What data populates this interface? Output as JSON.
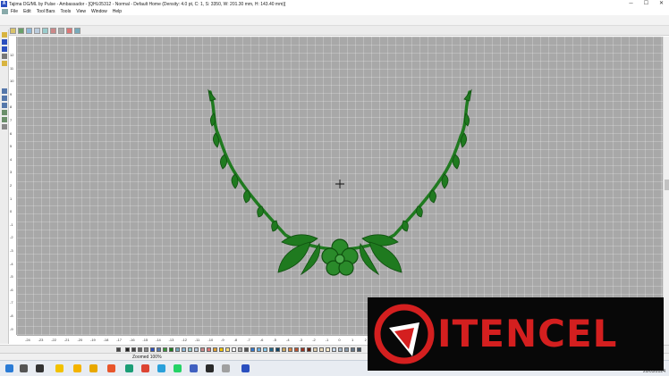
{
  "window": {
    "title": "Tajima DG/ML by Pulse - Ambassador - [QHL05312 - Normal - Default Home (Density: 4.0 pt, C: 1, S: 3350, W: 201.30 mm, H: 143.40 mm)]",
    "minimize": "─",
    "maximize": "☐",
    "close": "✕"
  },
  "menu": {
    "items": [
      "File",
      "Edit",
      "Tool Bars",
      "Tools",
      "View",
      "Window",
      "Help"
    ]
  },
  "rulers": {
    "bottom_ticks": [
      "-24",
      "-23",
      "-22",
      "-21",
      "-20",
      "-19",
      "-18",
      "-17",
      "-16",
      "-15",
      "-14",
      "-13",
      "-12",
      "-11",
      "-10",
      "-9",
      "-8",
      "-7",
      "-6",
      "-5",
      "-4",
      "-3",
      "-2",
      "-1",
      "0",
      "1",
      "2",
      "3",
      "4"
    ],
    "left_ticks": [
      "12",
      "11",
      "10",
      "9",
      "8",
      "7",
      "6",
      "5",
      "4",
      "3",
      "2",
      "1",
      "0",
      "-1",
      "-2",
      "-3",
      "-4",
      "-5",
      "-6",
      "-7",
      "-8",
      "-9"
    ]
  },
  "status": {
    "zoom_text": "Zoomed 100%"
  },
  "taskbar": {
    "date": "20/05/2024"
  },
  "watermark": {
    "brand": "ITENCEL"
  },
  "colors": {
    "design_green": "#1f7a1f",
    "canvas_gray": "#a8a8a8",
    "brand_red": "#d41f1f"
  }
}
